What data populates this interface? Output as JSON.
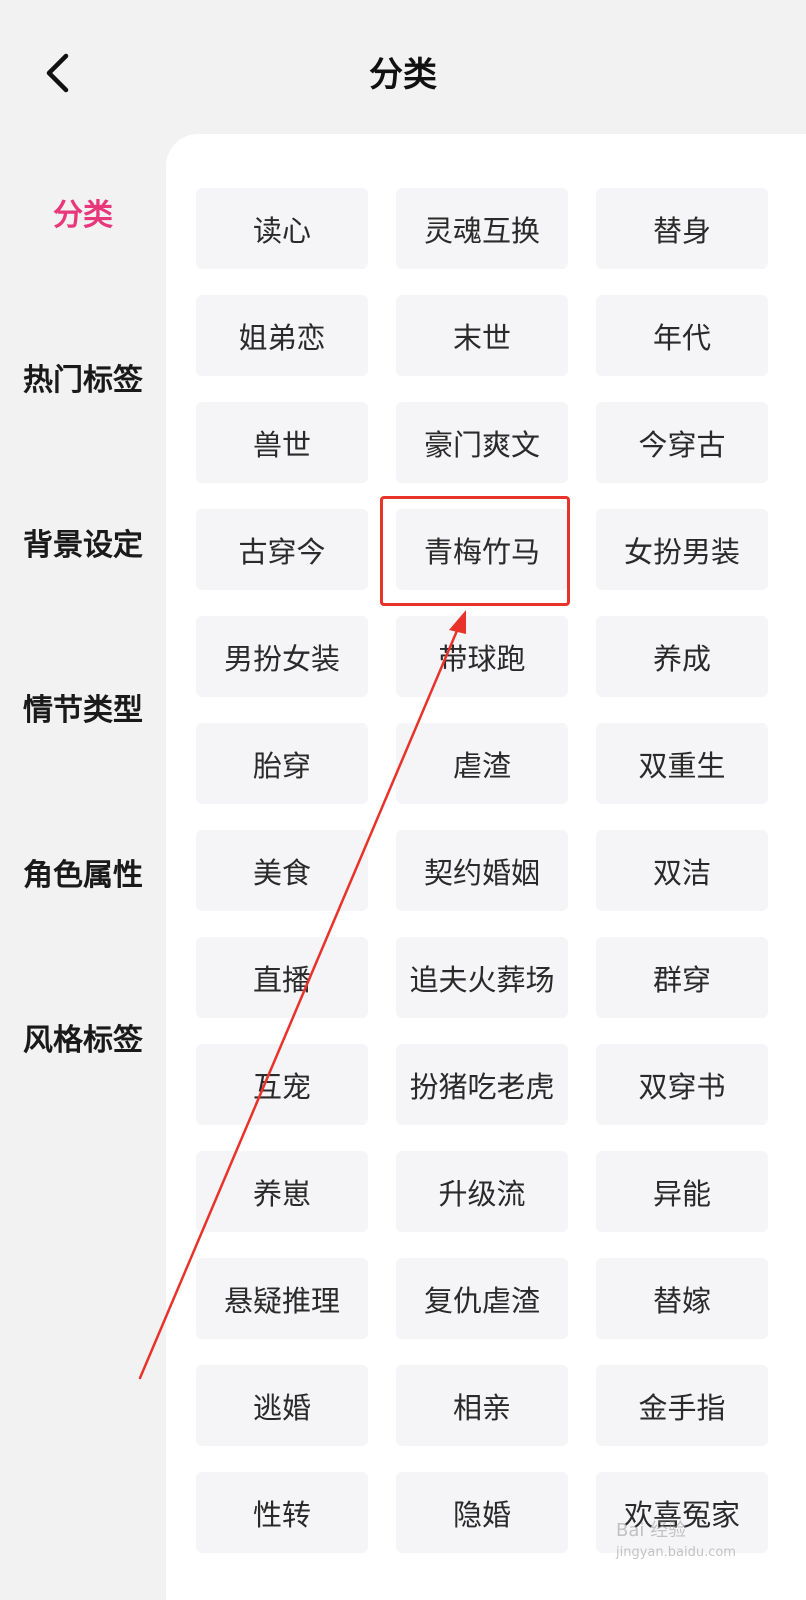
{
  "header": {
    "title": "分类"
  },
  "sidebar": {
    "items": [
      {
        "label": "分类",
        "active": true
      },
      {
        "label": "热门标签",
        "active": false
      },
      {
        "label": "背景设定",
        "active": false
      },
      {
        "label": "情节类型",
        "active": false
      },
      {
        "label": "角色属性",
        "active": false
      },
      {
        "label": "风格标签",
        "active": false
      }
    ]
  },
  "tags": [
    "读心",
    "灵魂互换",
    "替身",
    "姐弟恋",
    "末世",
    "年代",
    "兽世",
    "豪门爽文",
    "今穿古",
    "古穿今",
    "青梅竹马",
    "女扮男装",
    "男扮女装",
    "带球跑",
    "养成",
    "胎穿",
    "虐渣",
    "双重生",
    "美食",
    "契约婚姻",
    "双洁",
    "直播",
    "追夫火葬场",
    "群穿",
    "互宠",
    "扮猪吃老虎",
    "双穿书",
    "养崽",
    "升级流",
    "异能",
    "悬疑推理",
    "复仇虐渣",
    "替嫁",
    "逃婚",
    "相亲",
    "金手指",
    "性转",
    "隐婚",
    "欢喜冤家"
  ],
  "annotation": {
    "highlighted_tag": "青梅竹马",
    "color": "#e8322a"
  },
  "watermark": {
    "text": "Bai 经验",
    "sub": "jingyan.baidu.com"
  },
  "colors": {
    "accent": "#e8377a",
    "page_bg": "#f2f2f2",
    "panel_bg": "#ffffff",
    "tag_bg": "#f5f5f7"
  }
}
